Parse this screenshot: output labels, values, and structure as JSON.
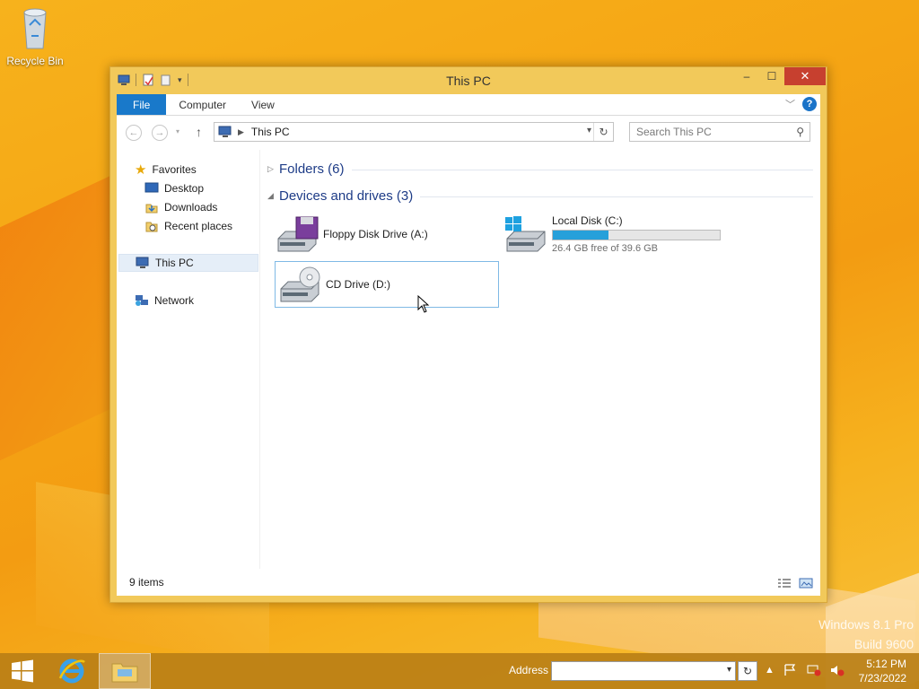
{
  "desktop": {
    "recycle_bin_label": "Recycle Bin",
    "watermark_line1": "Windows 8.1 Pro",
    "watermark_line2": "Build 9600"
  },
  "window": {
    "title": "This PC",
    "controls": {
      "minimize": "–",
      "maximize": "☐",
      "close": "✕"
    }
  },
  "ribbon": {
    "tabs": [
      "File",
      "Computer",
      "View"
    ],
    "help_label": "?"
  },
  "address_bar": {
    "location": "This PC",
    "search_placeholder": "Search This PC"
  },
  "nav_pane": {
    "favorites": "Favorites",
    "desktop": "Desktop",
    "downloads": "Downloads",
    "recent_places": "Recent places",
    "this_pc": "This PC",
    "network": "Network"
  },
  "content": {
    "folders_group": "Folders (6)",
    "devices_group": "Devices and drives (3)",
    "drives": [
      {
        "label": "Floppy Disk Drive (A:)",
        "icon": "floppy-drive-icon"
      },
      {
        "label": "Local Disk (C:)",
        "icon": "hard-drive-icon",
        "free_text": "26.4 GB free of 39.6 GB",
        "used_fraction": 0.333
      },
      {
        "label": "CD Drive (D:)",
        "icon": "cd-drive-icon"
      }
    ]
  },
  "status": {
    "items": "9 items"
  },
  "taskbar": {
    "address_label": "Address",
    "time": "5:12 PM",
    "date": "7/23/2022"
  },
  "colors": {
    "accent": "#1979ca",
    "progress": "#26a0da",
    "group_title": "#1e3c87"
  }
}
